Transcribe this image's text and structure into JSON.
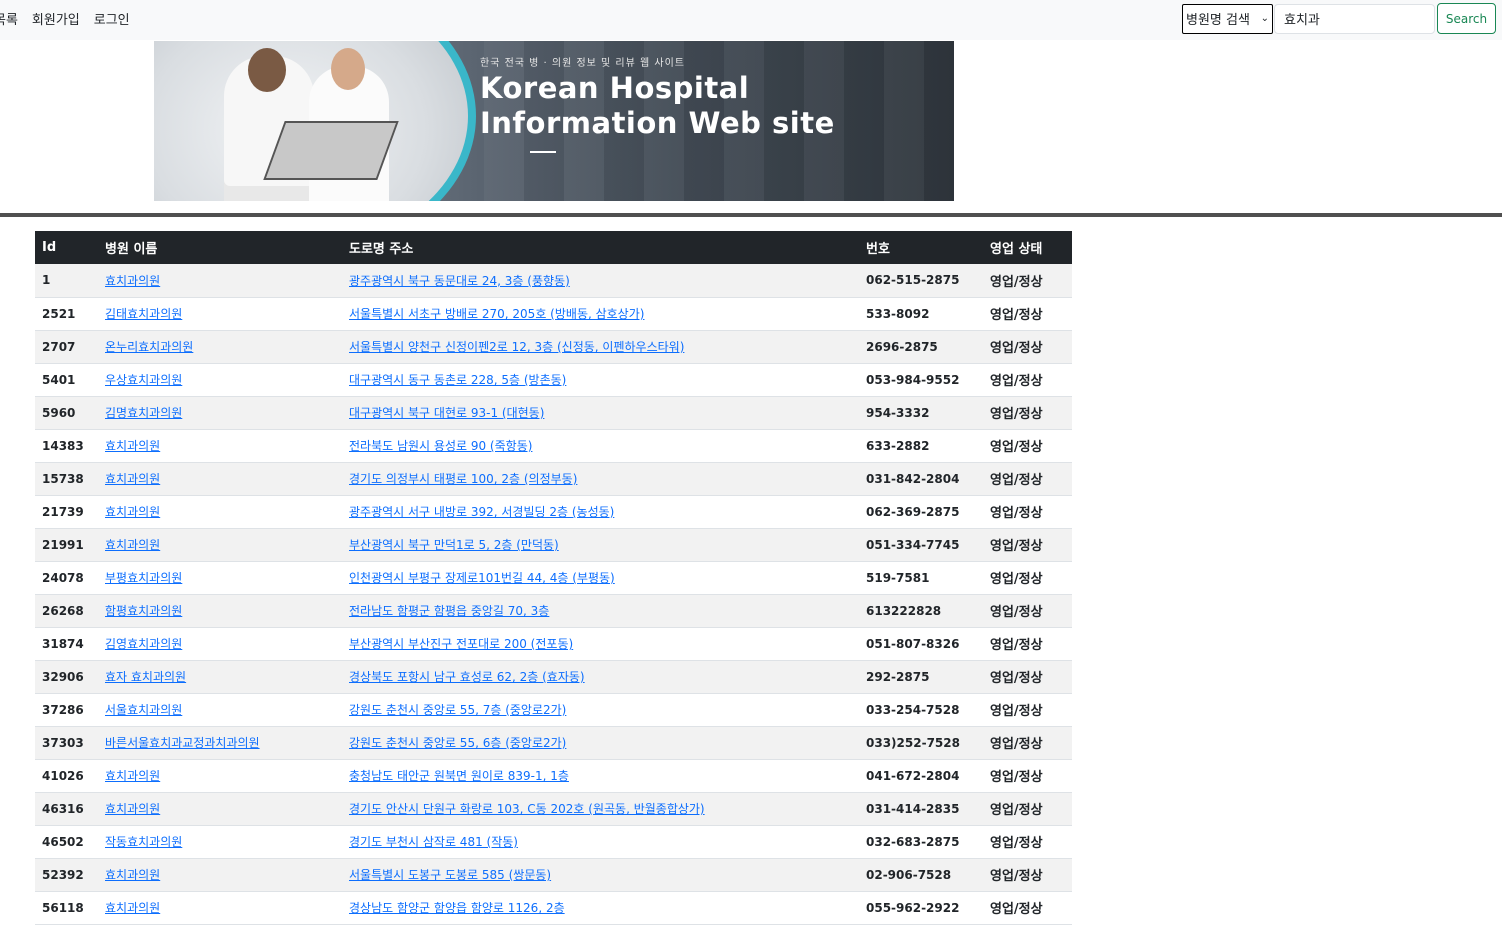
{
  "nav": {
    "links": [
      "목록",
      "회원가입",
      "로그인"
    ]
  },
  "search": {
    "select_value": "병원명 검색",
    "query": "효치과",
    "button_label": "Search"
  },
  "banner": {
    "subtitle": "한국 전국 병 · 의원 정보 및 리뷰 웹 사이트",
    "title_line1": "Korean Hospital",
    "title_line2": "Information Web site"
  },
  "table": {
    "headers": [
      "Id",
      "병원 이름",
      "도로명 주소",
      "번호",
      "영업 상태"
    ],
    "rows": [
      {
        "id": "1",
        "name": "효치과의원",
        "address": "광주광역시 북구 동문대로 24, 3층 (풍향동)",
        "phone": "062-515-2875",
        "status": "영업/정상"
      },
      {
        "id": "2521",
        "name": "김태효치과의원",
        "address": "서울특별시 서초구 방배로 270, 205호 (방배동, 삼호상가)",
        "phone": "533-8092",
        "status": "영업/정상"
      },
      {
        "id": "2707",
        "name": "온누리효치과의원",
        "address": "서울특별시 양천구 신정이펜2로 12, 3층 (신정동, 이펜하우스타워)",
        "phone": "2696-2875",
        "status": "영업/정상"
      },
      {
        "id": "5401",
        "name": "우상효치과의원",
        "address": "대구광역시 동구 동촌로 228, 5층 (방촌동)",
        "phone": "053-984-9552",
        "status": "영업/정상"
      },
      {
        "id": "5960",
        "name": "김명효치과의원",
        "address": "대구광역시 북구 대현로 93-1 (대현동)",
        "phone": "954-3332",
        "status": "영업/정상"
      },
      {
        "id": "14383",
        "name": "효치과의원",
        "address": "전라북도 남원시 용성로 90 (죽항동)",
        "phone": "633-2882",
        "status": "영업/정상"
      },
      {
        "id": "15738",
        "name": "효치과의원",
        "address": "경기도 의정부시 태평로 100, 2층 (의정부동)",
        "phone": "031-842-2804",
        "status": "영업/정상"
      },
      {
        "id": "21739",
        "name": "효치과의원",
        "address": "광주광역시 서구 내방로 392, 서경빌딩 2층 (농성동)",
        "phone": "062-369-2875",
        "status": "영업/정상"
      },
      {
        "id": "21991",
        "name": "효치과의원",
        "address": "부산광역시 북구 만덕1로 5, 2층 (만덕동)",
        "phone": "051-334-7745",
        "status": "영업/정상"
      },
      {
        "id": "24078",
        "name": "부평효치과의원",
        "address": "인천광역시 부평구 장제로101번길 44, 4층 (부평동)",
        "phone": "519-7581",
        "status": "영업/정상"
      },
      {
        "id": "26268",
        "name": "함평효치과의원",
        "address": "전라남도 함평군 함평읍 중앙길 70, 3층",
        "phone": "613222828",
        "status": "영업/정상"
      },
      {
        "id": "31874",
        "name": "김영효치과의원",
        "address": "부산광역시 부산진구 전포대로 200 (전포동)",
        "phone": "051-807-8326",
        "status": "영업/정상"
      },
      {
        "id": "32906",
        "name": "효자 효치과의원",
        "address": "경상북도 포항시 남구 효성로 62, 2층 (효자동)",
        "phone": "292-2875",
        "status": "영업/정상"
      },
      {
        "id": "37286",
        "name": "서울효치과의원",
        "address": "강원도 춘천시 중앙로 55, 7층 (중앙로2가)",
        "phone": "033-254-7528",
        "status": "영업/정상"
      },
      {
        "id": "37303",
        "name": "바른서울효치과교정과치과의원",
        "address": "강원도 춘천시 중앙로 55, 6층 (중앙로2가)",
        "phone": "033)252-7528",
        "status": "영업/정상"
      },
      {
        "id": "41026",
        "name": "효치과의원",
        "address": "충청남도 태안군 원북면 원이로 839-1, 1층",
        "phone": "041-672-2804",
        "status": "영업/정상"
      },
      {
        "id": "46316",
        "name": "효치과의원",
        "address": "경기도 안산시 단원구 화랑로 103, C동 202호 (원곡동, 반월종합상가)",
        "phone": "031-414-2835",
        "status": "영업/정상"
      },
      {
        "id": "46502",
        "name": "작동효치과의원",
        "address": "경기도 부천시 삼작로 481 (작동)",
        "phone": "032-683-2875",
        "status": "영업/정상"
      },
      {
        "id": "52392",
        "name": "효치과의원",
        "address": "서울특별시 도봉구 도봉로 585 (쌍문동)",
        "phone": "02-906-7528",
        "status": "영업/정상"
      },
      {
        "id": "56118",
        "name": "효치과의원",
        "address": "경상남도 함양군 함양읍 함양로 1126, 2층",
        "phone": "055-962-2922",
        "status": "영업/정상"
      }
    ]
  },
  "colors": {
    "header_bg": "#212529",
    "link": "#0d6efd",
    "search_button": "#198754",
    "stripe": "#f2f2f2"
  }
}
